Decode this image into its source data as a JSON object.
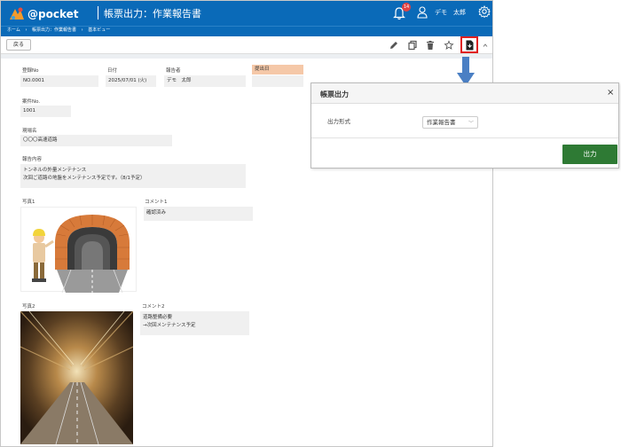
{
  "header": {
    "logo_text": "@pocket",
    "title": "帳票出力：作業報告書",
    "notification_count": "14",
    "user_name": "デモ　太郎"
  },
  "breadcrumb": {
    "items": [
      "ホーム",
      "›",
      "帳票出力：作業報告書",
      "›",
      "基本ビュー"
    ]
  },
  "toolbar": {
    "back_label": "戻る"
  },
  "form": {
    "fields": {
      "registration_no": {
        "label": "登録No",
        "value": "NO.0001"
      },
      "date": {
        "label": "日付",
        "value": "2025/07/01 (火)"
      },
      "reporter": {
        "label": "報告者",
        "value": "デモ　太郎"
      },
      "submit_date": {
        "label": "提出日",
        "value": ""
      },
      "case_no": {
        "label": "案件No.",
        "value": "1001"
      },
      "site_name": {
        "label": "現場名",
        "value": "〇〇〇高速道路"
      },
      "report_content": {
        "label": "報告内容",
        "line1": "トンネルの外量メンテナンス",
        "line2": "次回ご道路の地盤をメンテナンス予定です。（8/1予定）"
      },
      "photo1": {
        "label": "写真1"
      },
      "comment1": {
        "label": "コメント1",
        "value": "確認済み"
      },
      "photo2": {
        "label": "写真2"
      },
      "comment2": {
        "label": "コメント2",
        "line1": "道路整備必要",
        "line2": "→次回メンテナンス予定"
      }
    }
  },
  "dialog": {
    "title": "帳票出力",
    "close": "×",
    "format_label": "出力形式",
    "format_value": "作業報告書",
    "output_button": "出力"
  },
  "colors": {
    "header_blue": "#0a6ab8",
    "highlight_red": "#e02020",
    "arrow_blue": "#4a7fc4",
    "output_green": "#2e7a34",
    "submit_date_bg": "#f5c8a8"
  }
}
